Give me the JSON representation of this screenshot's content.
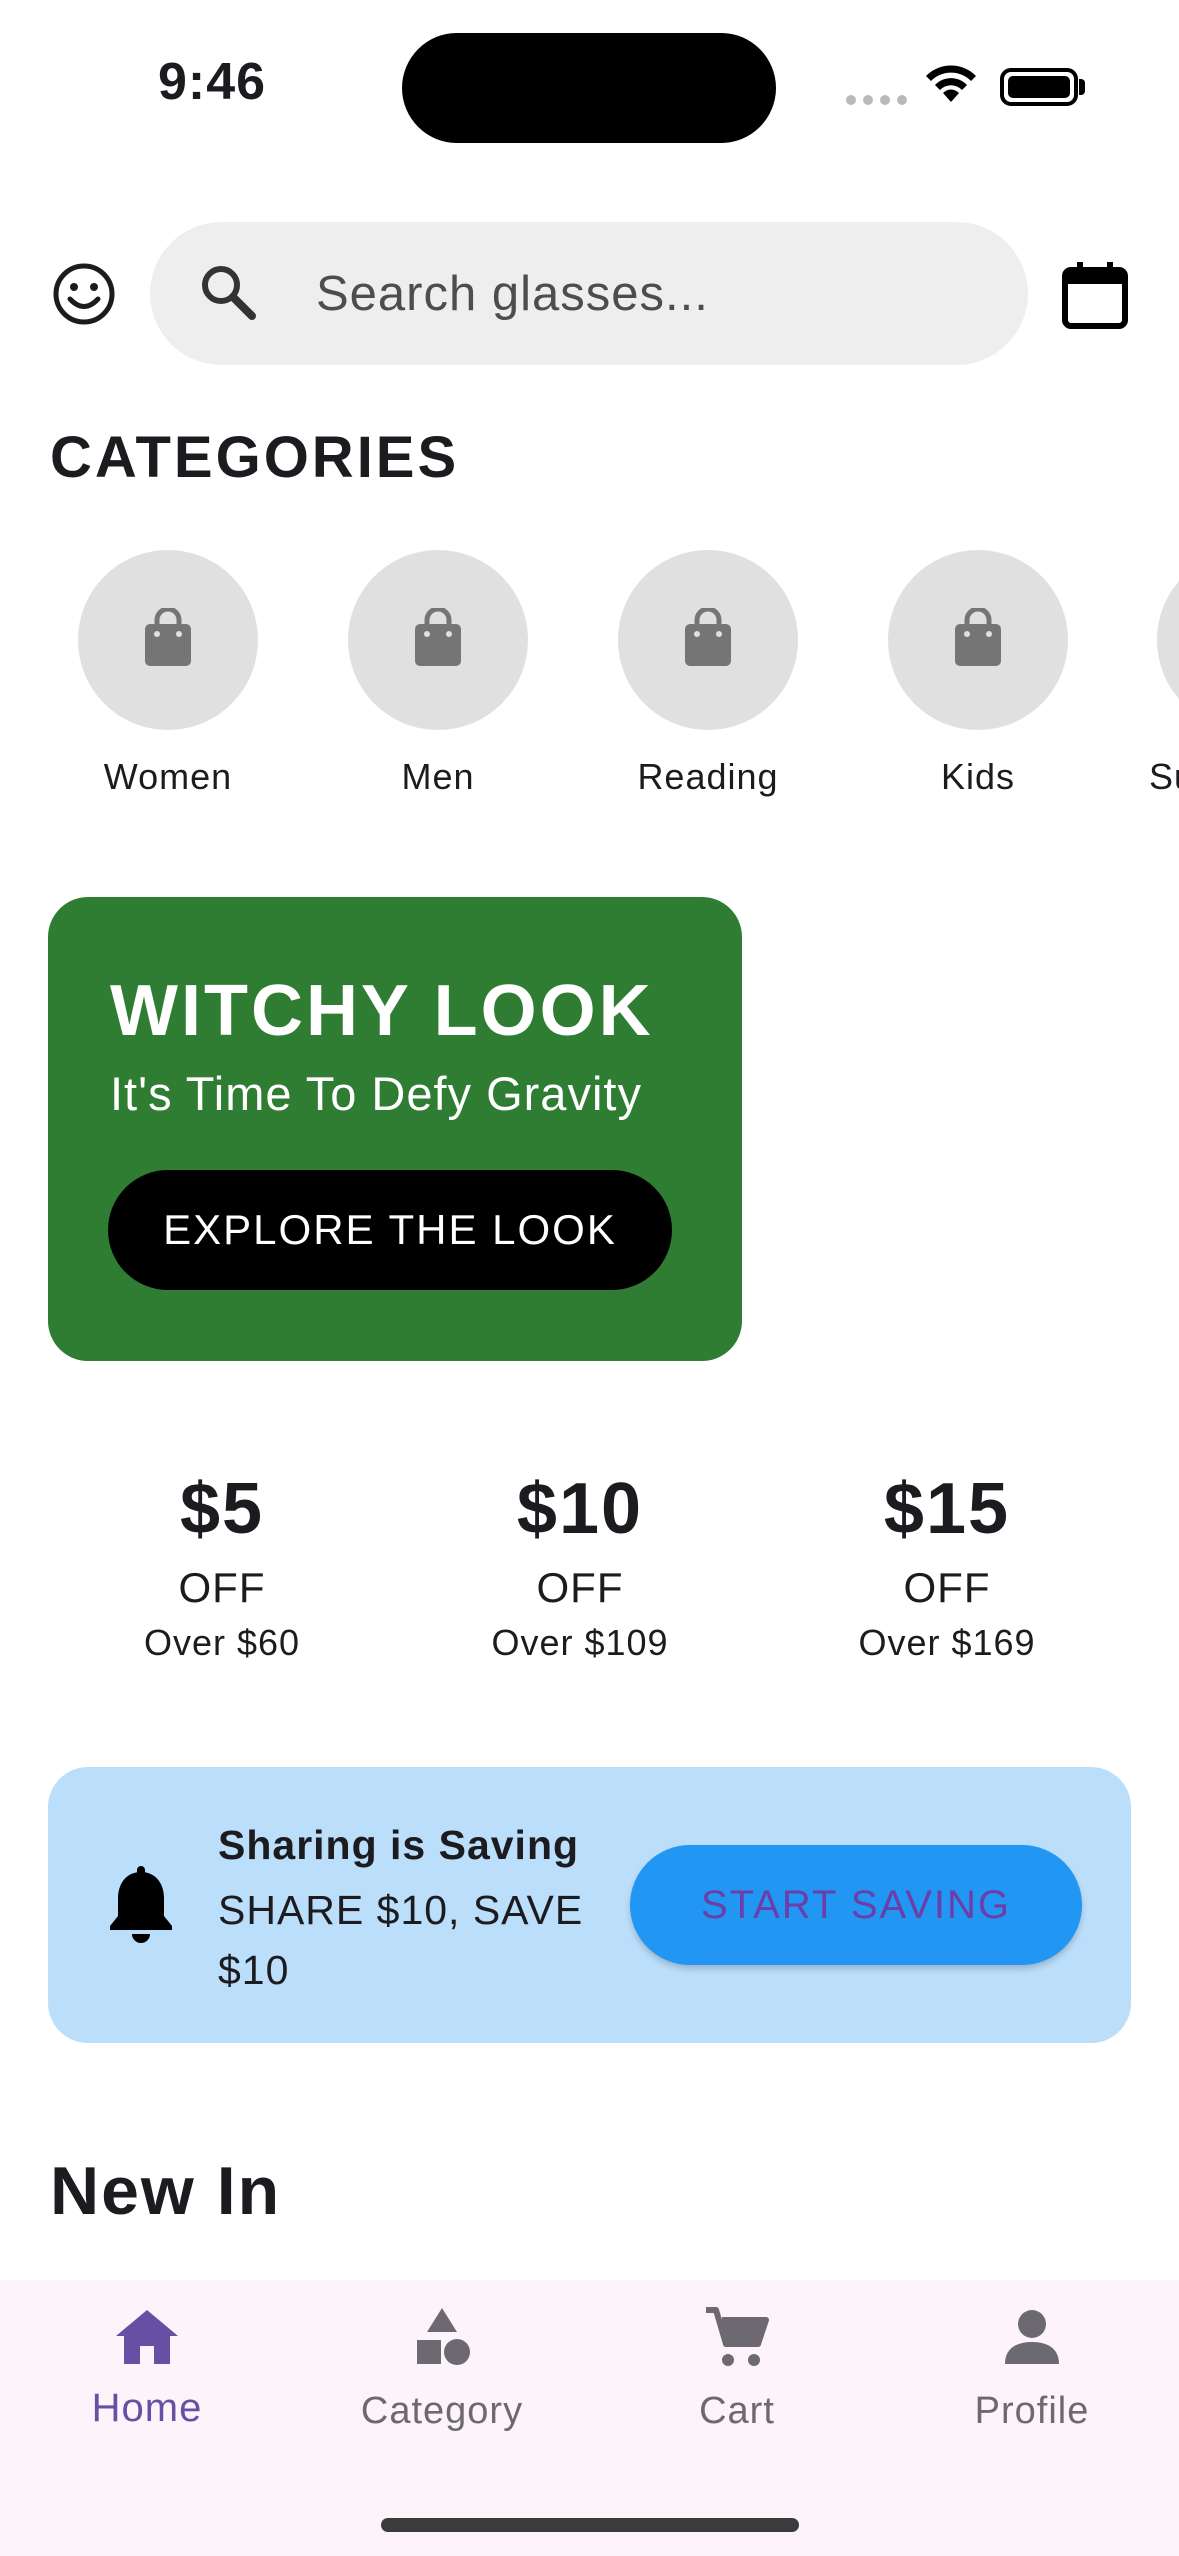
{
  "status_bar": {
    "time": "9:46"
  },
  "header": {
    "search_placeholder": "Search glasses...",
    "icons": [
      "smiley-icon",
      "search-icon",
      "calendar-icon"
    ]
  },
  "categories": {
    "title": "CATEGORIES",
    "items": [
      {
        "label": "Women",
        "icon": "shopping-bag-icon"
      },
      {
        "label": "Men",
        "icon": "shopping-bag-icon"
      },
      {
        "label": "Reading",
        "icon": "shopping-bag-icon"
      },
      {
        "label": "Kids",
        "icon": "shopping-bag-icon"
      },
      {
        "label": "Su",
        "icon": "shopping-bag-icon"
      }
    ]
  },
  "promo": {
    "title": "WITCHY LOOK",
    "subtitle": "It's Time To Defy Gravity",
    "button": "EXPLORE THE LOOK",
    "color": "#2e7d32"
  },
  "discounts": [
    {
      "amount": "$5",
      "off": "OFF",
      "condition": "Over $60"
    },
    {
      "amount": "$10",
      "off": "OFF",
      "condition": "Over $109"
    },
    {
      "amount": "$15",
      "off": "OFF",
      "condition": "Over $169"
    }
  ],
  "sharing": {
    "title": "Sharing is Saving",
    "subtitle": "SHARE $10, SAVE $10",
    "button": "START SAVING",
    "icon": "bell-icon",
    "background": "#bbdefb",
    "button_color": "#2196f3"
  },
  "new_in": {
    "title": "New In"
  },
  "bottom_nav": {
    "active": "Home",
    "accent": "#6750a4",
    "items": [
      {
        "label": "Home",
        "icon": "home-icon"
      },
      {
        "label": "Category",
        "icon": "category-icon"
      },
      {
        "label": "Cart",
        "icon": "cart-icon"
      },
      {
        "label": "Profile",
        "icon": "profile-icon"
      }
    ]
  }
}
